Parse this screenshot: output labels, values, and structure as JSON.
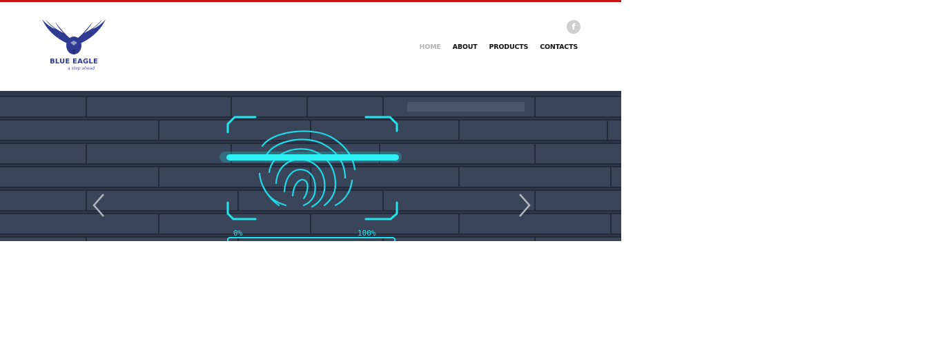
{
  "brand": {
    "name": "BLUE EAGLE",
    "tagline": "a step ahead",
    "logo_icon": "eagle-logo"
  },
  "header": {
    "social_icon": "facebook-icon",
    "social_glyph": "f"
  },
  "nav": {
    "items": [
      {
        "label": "HOME",
        "active": true
      },
      {
        "label": "ABOUT",
        "active": false
      },
      {
        "label": "PRODUCTS",
        "active": false
      },
      {
        "label": "CONTACTS",
        "active": false
      }
    ]
  },
  "slider": {
    "image": "fingerprint-scan-on-brick-wall",
    "scan_start_label": "0%",
    "scan_end_label": "100%",
    "prev_icon": "chevron-left-icon",
    "next_icon": "chevron-right-icon"
  },
  "colors": {
    "accent_bar": "#c8140f",
    "brand_blue": "#2f3a93",
    "scan_cyan": "#22e6ef",
    "nav_active": "#b5b5b5"
  }
}
